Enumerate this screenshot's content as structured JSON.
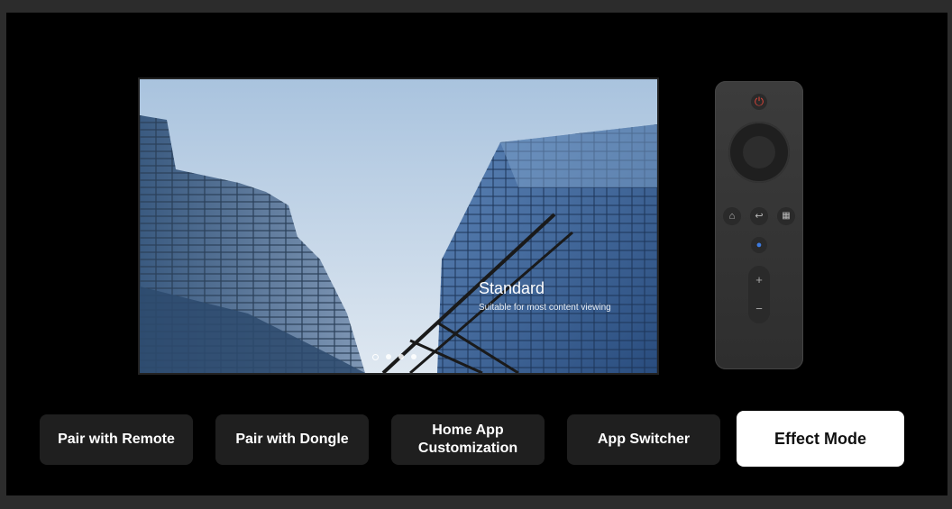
{
  "preview": {
    "mode_title": "Standard",
    "mode_subtitle": "Suitable for most content viewing",
    "carousel_dots": 4,
    "active_dot": 0
  },
  "remote": {
    "power_icon": "power-icon",
    "home_icon": "home-icon",
    "back_icon": "back-icon",
    "menu_icon": "menu-icon",
    "mic_icon": "microphone-icon",
    "volume_up": "+",
    "volume_down": "−"
  },
  "tabs": [
    {
      "label": "Pair with Remote",
      "active": false
    },
    {
      "label": "Pair with Dongle",
      "active": false
    },
    {
      "label": "Home App Customization",
      "active": false
    },
    {
      "label": "App Switcher",
      "active": false
    },
    {
      "label": "Effect Mode",
      "active": true
    }
  ],
  "colors": {
    "background": "#000000",
    "tab_bg": "#1f1f1f",
    "tab_active_bg": "#ffffff",
    "power_red": "#e0453a",
    "mic_blue": "#3d7be0"
  }
}
